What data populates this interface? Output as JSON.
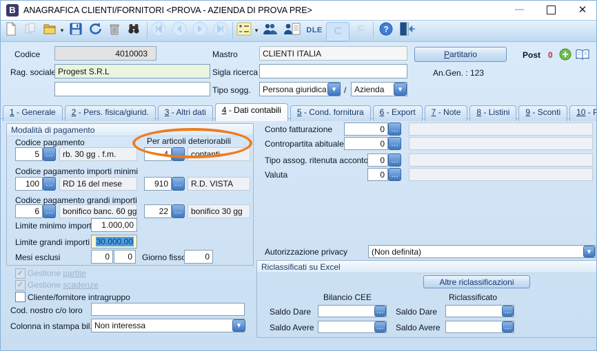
{
  "window": {
    "title": "ANAGRAFICA CLIENTI/FORNITORI <PROVA - AZIENDA DI PROVA PRE>",
    "app_initial": "B",
    "controls": {
      "close": "✕"
    }
  },
  "toolbar": {
    "dle_label": "DLE",
    "c_label": "C",
    "f_label": "F",
    "help_label": "?"
  },
  "header": {
    "codice_label": "Codice",
    "codice_value": "4010003",
    "rag_sociale_label": "Rag. sociale",
    "rag_sociale_value": "Progest S.R.L",
    "mastro_label": "Mastro",
    "mastro_value": "CLIENTI ITALIA",
    "sigla_label": "Sigla ricerca",
    "sigla_value": "",
    "tipo_sogg_label": "Tipo sogg.",
    "tipo_sogg_value1": "Persona giuridica",
    "tipo_sogg_separator": "/",
    "tipo_sogg_value2": "Azienda",
    "partitario_initial": "P",
    "partitario_rest": "artitario",
    "post_label": "Post",
    "post_value": "0",
    "angen_text": "An.Gen.  :  123"
  },
  "tabs": {
    "items": [
      {
        "num": "1",
        "text": " - Generale"
      },
      {
        "num": "2",
        "text": " - Pers. fisica/giurid."
      },
      {
        "num": "3",
        "text": " - Altri dati"
      },
      {
        "num": "4",
        "text": " - Dati contabili"
      },
      {
        "num": "5",
        "text": " - Cond. fornitura"
      },
      {
        "num": "6",
        "text": " - Export"
      },
      {
        "num": "7",
        "text": " - Note"
      },
      {
        "num": "8",
        "text": " - Listini"
      },
      {
        "num": "9",
        "text": " - Sconti"
      },
      {
        "num": "10",
        "text": " - Provvig."
      }
    ],
    "active_index": 3
  },
  "payment": {
    "group_title": "Modalità di pagamento",
    "codice_pagamento_label": "Codice pagamento",
    "deteriorabili_label": "Per articoli deteriorabili",
    "row1": {
      "code": "5",
      "desc": "rb. 30 gg . f.m.",
      "code2": "4",
      "desc2": "contanti"
    },
    "importi_minimi_label": "Codice pagamento importi minimi",
    "row2": {
      "code": "100",
      "desc": "RD 16 del mese",
      "code2": "910",
      "desc2": "R.D. VISTA"
    },
    "grandi_importi_label": "Codice pagamento grandi importi",
    "row3": {
      "code": "6",
      "desc": "bonifico banc. 60 gg",
      "code2": "22",
      "desc2": "bonifico 30 gg"
    },
    "limite_minimo_label": "Limite minimo importo",
    "limite_minimo_value": "1.000,00",
    "limite_grandi_label": "Limite grandi importi",
    "limite_grandi_value": "30.000,00",
    "mesi_esclusi_label": "Mesi esclusi",
    "mesi_value1": "0",
    "mesi_value2": "0",
    "giorno_fisso_label": "Giorno fisso",
    "giorno_fisso_value": "0"
  },
  "flags": {
    "gestione_partite_prefix": "Gestione ",
    "gestione_partite_word": "partite",
    "gestione_scadenze_prefix": "Gestione ",
    "gestione_scadenze_word": "scadenze",
    "intragruppo_label": "Cliente/fornitore intragruppo",
    "cod_nostro_label": "Cod. nostro c/o loro",
    "cod_nostro_value": "",
    "colonna_label": "Colonna in stampa bil.",
    "colonna_value": "Non interessa"
  },
  "accounting": {
    "conto_fatturazione_label": "Conto fatturazione",
    "conto_fatturazione_value": "0",
    "contropartita_label": "Contropartita abituale",
    "contropartita_value": "0",
    "tipo_assog_label": "Tipo assog. ritenuta acconto",
    "tipo_assog_value": "0",
    "valuta_label": "Valuta",
    "valuta_value": "0",
    "privacy_label": "Autorizzazione privacy",
    "privacy_value": "(Non definita)"
  },
  "riclass": {
    "group_title": "Riclassificati su Excel",
    "button_label": "Altre riclassificazioni",
    "col1_header": "Bilancio CEE",
    "col2_header": "Riclassificato",
    "saldo_dare_label": "Saldo Dare",
    "saldo_avere_label": "Saldo Avere"
  },
  "icons": {
    "ellipsis": "…",
    "dropdown_arrow": "▾",
    "check": "✓",
    "plus": "+",
    "minimize": "–"
  },
  "colors": {
    "annotation_orange": "#ee7c1e",
    "selection_blue": "#4fa0e4",
    "post_zero_red": "#d21f3c",
    "field_green": "#eaf4df",
    "field_yellow": "#fdf6ce",
    "field_gray": "#e3e3e3",
    "accent_blue": "#3c77c2"
  }
}
